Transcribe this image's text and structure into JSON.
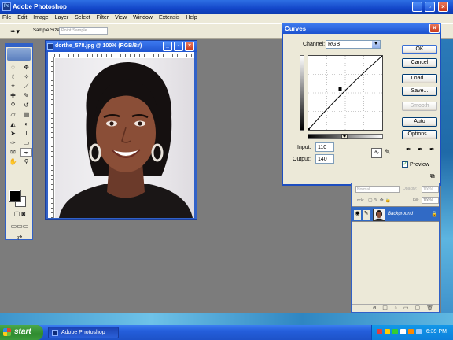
{
  "app": {
    "title": "Adobe Photoshop"
  },
  "menu": [
    "File",
    "Edit",
    "Image",
    "Layer",
    "Select",
    "Filter",
    "View",
    "Window",
    "Extensis",
    "Help"
  ],
  "options_bar": {
    "sample_size_label": "Sample Size:",
    "sample_size_value": "Point Sample"
  },
  "document": {
    "title": "dorthe_578.jpg @ 100% (RGB/8#)"
  },
  "curves": {
    "title": "Curves",
    "channel_label": "Channel:",
    "channel_value": "RGB",
    "input_label": "Input:",
    "input_value": "110",
    "output_label": "Output:",
    "output_value": "140",
    "buttons": {
      "ok": "OK",
      "cancel": "Cancel",
      "load": "Load...",
      "save": "Save...",
      "smooth": "Smooth",
      "auto": "Auto",
      "options": "Options..."
    },
    "preview_label": "Preview",
    "preview_checked": true
  },
  "layers": {
    "blend_mode": "Normal",
    "opacity_label": "Opacity:",
    "opacity_value": "100%",
    "lock_label": "Lock:",
    "fill_label": "Fill:",
    "fill_value": "100%",
    "layer_name": "Background"
  },
  "taskbar": {
    "start_label": "start",
    "task_item": "Adobe Photoshop",
    "clock": "6:39 PM"
  },
  "colors": {
    "accent": "#316ac5",
    "title_bar": "#1f54d0",
    "start_green": "#2f8b2f"
  }
}
